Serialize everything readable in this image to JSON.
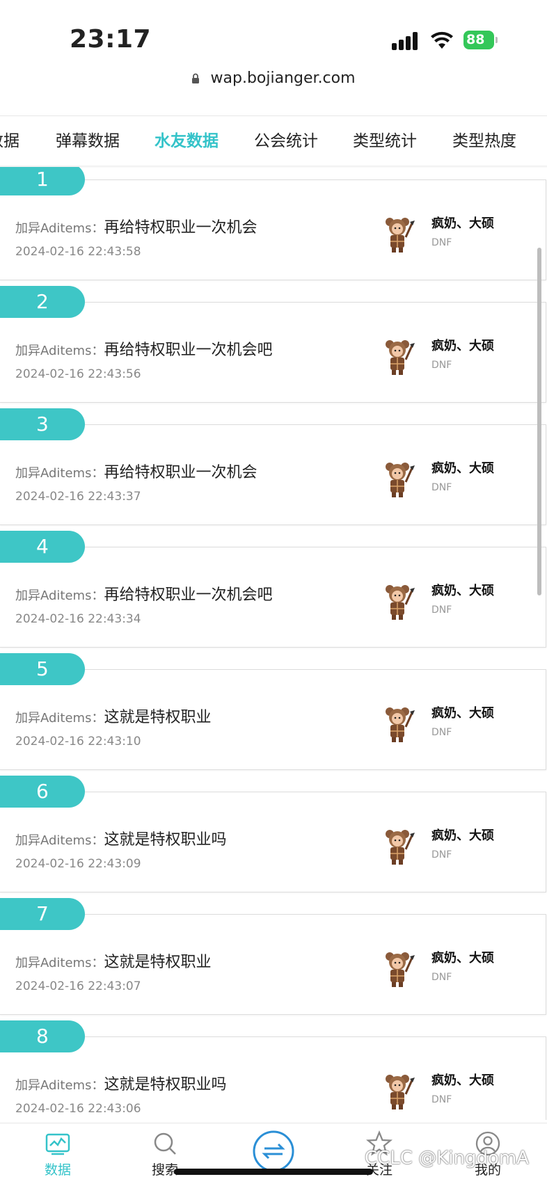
{
  "status": {
    "time": "23:17",
    "battery": "88"
  },
  "browser": {
    "url": "wap.bojianger.com"
  },
  "tabs": [
    {
      "label": "数据"
    },
    {
      "label": "弹幕数据"
    },
    {
      "label": "水友数据"
    },
    {
      "label": "公会统计"
    },
    {
      "label": "类型统计"
    },
    {
      "label": "类型热度"
    }
  ],
  "active_tab": "水友数据",
  "items": [
    {
      "rank": "1",
      "user": "加异Aditems：",
      "text": "再给特权职业一次机会",
      "time": "2024-02-16 22:43:58",
      "anchor": "疯奶、大硕",
      "game": "DNF"
    },
    {
      "rank": "2",
      "user": "加异Aditems：",
      "text": "再给特权职业一次机会吧",
      "time": "2024-02-16 22:43:56",
      "anchor": "疯奶、大硕",
      "game": "DNF"
    },
    {
      "rank": "3",
      "user": "加异Aditems：",
      "text": "再给特权职业一次机会",
      "time": "2024-02-16 22:43:37",
      "anchor": "疯奶、大硕",
      "game": "DNF"
    },
    {
      "rank": "4",
      "user": "加异Aditems：",
      "text": "再给特权职业一次机会吧",
      "time": "2024-02-16 22:43:34",
      "anchor": "疯奶、大硕",
      "game": "DNF"
    },
    {
      "rank": "5",
      "user": "加异Aditems：",
      "text": "这就是特权职业",
      "time": "2024-02-16 22:43:10",
      "anchor": "疯奶、大硕",
      "game": "DNF"
    },
    {
      "rank": "6",
      "user": "加异Aditems：",
      "text": "这就是特权职业吗",
      "time": "2024-02-16 22:43:09",
      "anchor": "疯奶、大硕",
      "game": "DNF"
    },
    {
      "rank": "7",
      "user": "加异Aditems：",
      "text": "这就是特权职业",
      "time": "2024-02-16 22:43:07",
      "anchor": "疯奶、大硕",
      "game": "DNF"
    },
    {
      "rank": "8",
      "user": "加异Aditems：",
      "text": "这就是特权职业吗",
      "time": "2024-02-16 22:43:06",
      "anchor": "疯奶、大硕",
      "game": "DNF"
    }
  ],
  "bottom_nav": [
    {
      "label": "数据",
      "icon": "chart-icon"
    },
    {
      "label": "搜索",
      "icon": "search-icon"
    },
    {
      "label": "",
      "icon": "swap-icon"
    },
    {
      "label": "关注",
      "icon": "star-icon"
    },
    {
      "label": "我的",
      "icon": "user-icon"
    }
  ],
  "watermark": "CCLC @KingdomA",
  "colors": {
    "accent": "#34c3c9",
    "rank_badge": "#3ec6c6",
    "battery": "#34c759"
  }
}
